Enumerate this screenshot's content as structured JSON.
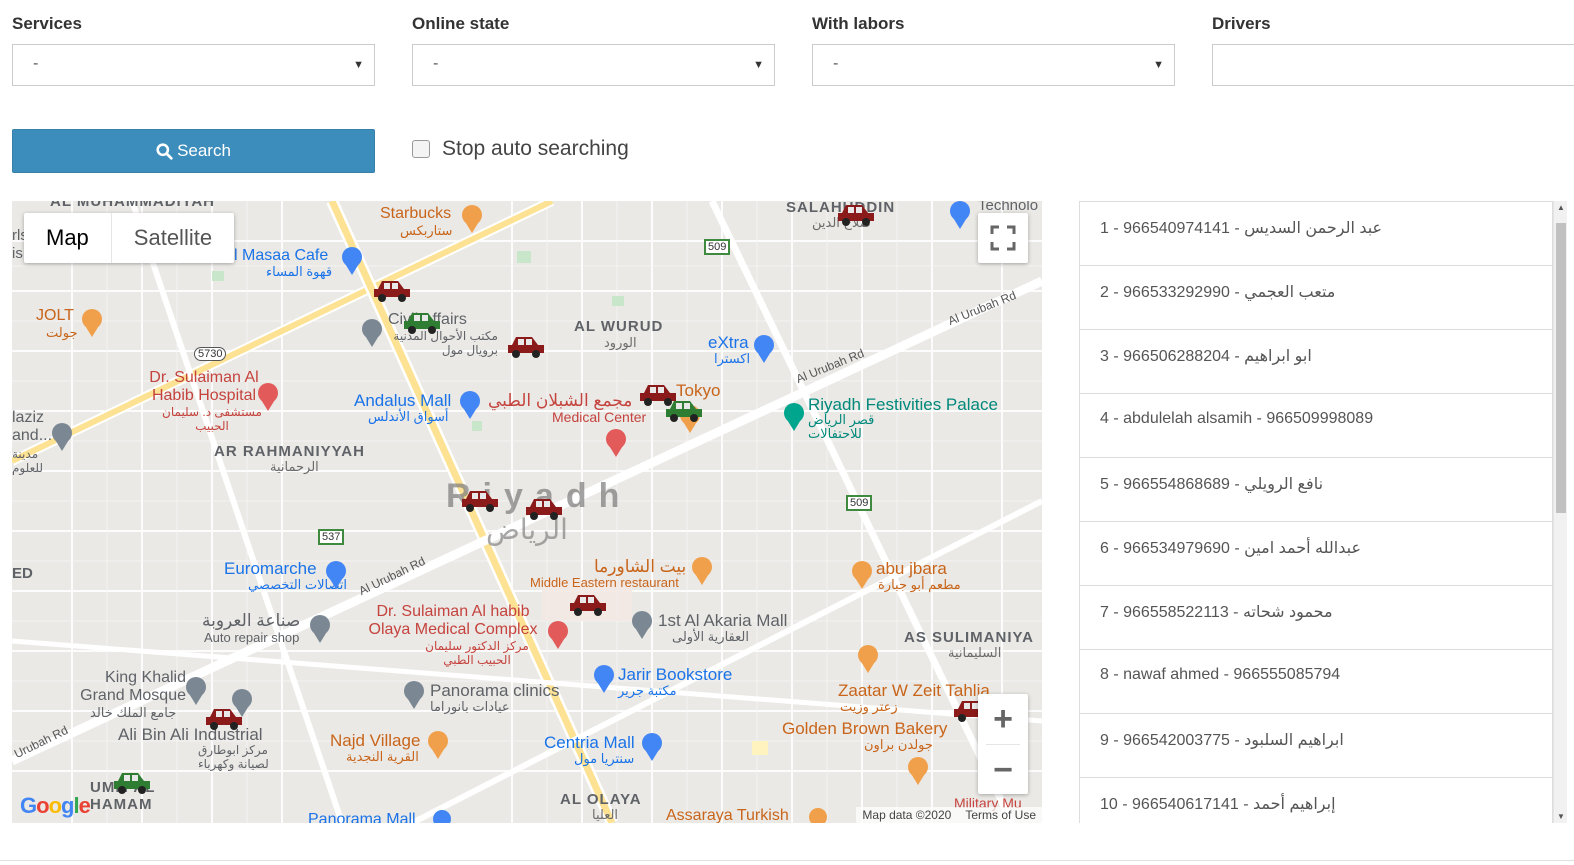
{
  "filters": {
    "services": {
      "label": "Services",
      "value": "-"
    },
    "online_state": {
      "label": "Online state",
      "value": "-"
    },
    "with_labors": {
      "label": "With labors",
      "value": "-"
    },
    "drivers": {
      "label": "Drivers",
      "value": ""
    }
  },
  "search_button": {
    "label": "Search",
    "icon": "search-icon"
  },
  "stop_auto": {
    "label": "Stop auto searching",
    "checked": false
  },
  "map": {
    "type_controls": {
      "map": "Map",
      "satellite": "Satellite",
      "selected": "Map"
    },
    "attribution": {
      "data": "Map data ©2020",
      "terms": "Terms of Use"
    },
    "logo": "Google",
    "city": {
      "name_en": "Riyadh",
      "name_ar": "الرياض"
    },
    "labels": {
      "salahuddin": "SALAHUDDIN",
      "salahuddin_ar": "صلاح الدين",
      "al_wurud": "AL WURUD",
      "al_wurud_ar": "الورود",
      "ar_rahmaniyyah": "AR RAHMANIYYAH",
      "ar_rahmaniyyah_ar": "الرحمانية",
      "as_sulimaniya": "AS SULIMANIYA",
      "as_sulimaniya_ar": "السليمانية",
      "al_olaya": "AL OLAYA",
      "al_olaya_ar": "العليا",
      "umm_al_hamam": "UMM AL HAMAM",
      "al_muhammadiyah": "AL MUHAMMADIYAH",
      "starbucks": "Starbucks",
      "starbucks_ar": "ستاربكس",
      "masaa_cafe": "l Masaa Cafe",
      "masaa_cafe_ar": "قهوة المساء",
      "jolt": "JOLT",
      "jolt_ar": "جولت",
      "civil_affairs": "Civil Affairs",
      "civil_affairs_ar": "مكتب الأحوال المدنية برويال مول",
      "extra": "eXtra",
      "extra_ar": "اكسترا",
      "dr_sulaiman_habib": "Dr. Sulaiman Al Habib Hospital",
      "dr_sulaiman_habib_ar": "مستشفى د. سليمان الحبيب",
      "andalus_mall": "Andalus Mall",
      "andalus_mall_ar": "أسواق الأندلس",
      "shblan_medical": "مجمع الشبلان الطبي",
      "medical_center": "Medical Center",
      "tokyo": "Tokyo",
      "festivities_palace": "Riyadh Festivities Palace",
      "festivities_palace_ar": "قصر الرياض للاحتفالات",
      "euromarche": "Euromarche",
      "euromarche_ar": "اتصالات التخصصي",
      "shawarma_house": "بيت الشاورما",
      "middle_eastern": "Middle Eastern restaurant",
      "abu_jbara": "abu jbara",
      "abu_jbara_ar": "مطعم أبو جبارة",
      "auto_repair": "صناعة العروبة",
      "auto_repair_en": "Auto repair shop",
      "olaya_medical": "Dr. Sulaiman Al habib Olaya Medical Complex",
      "olaya_medical_ar": "مركز الدكتور سليمان الحبيب الطبي",
      "akaria_mall": "1st Al Akaria Mall",
      "akaria_mall_ar": "العقارية الأولى",
      "jarir": "Jarir Bookstore",
      "jarir_ar": "مكتبة جرير",
      "king_khalid": "King Khalid Grand Mosque",
      "king_khalid_ar": "جامع الملك خالد",
      "panorama_clinics": "Panorama clinics",
      "panorama_clinics_ar": "عيادات بانوراما",
      "zaatar": "Zaatar W Zeit Tahlia",
      "zaatar_ar": "زعتر وزيت",
      "ali_bin_ali": "Ali Bin Ali Industrial",
      "ali_bin_ali_ar": "مركز ابوطارق لصيانة وكهرباء",
      "najd_village": "Najd Village",
      "najd_village_ar": "القرية النجدية",
      "centria_mall": "Centria Mall",
      "centria_mall_ar": "سنتريا مول",
      "golden_brown": "Golden Brown Bakery",
      "golden_brown_ar": "جولدن براون",
      "panorama_mall": "Panorama Mall",
      "assaraya": "Assaraya Turkish",
      "military": "Military Mu",
      "road_urubah_1": "Al Urubah Rd",
      "road_urubah_2": "Al Urubah Rd",
      "road_urubah_3": "Al Urubah Rd",
      "road_urubah_4": "Urubah Rd",
      "shield_509a": "509",
      "shield_509b": "509",
      "shield_537": "537",
      "shield_5730": "5730",
      "aziz": "laziz",
      "and": "and...",
      "aziz_ar": "مدينة للعلوم",
      "rls": "rls",
      "is": "is",
      "ed": "ED",
      "technolo": "Technolo"
    },
    "cars": [
      {
        "color": "#8b1a1a",
        "status": "red"
      },
      {
        "color": "#2e7d32",
        "status": "green"
      },
      {
        "color": "#8b1a1a",
        "status": "red"
      },
      {
        "color": "#8b1a1a",
        "status": "red"
      },
      {
        "color": "#2e7d32",
        "status": "green"
      },
      {
        "color": "#8b1a1a",
        "status": "red"
      },
      {
        "color": "#8b1a1a",
        "status": "red"
      },
      {
        "color": "#8b1a1a",
        "status": "red"
      },
      {
        "color": "#8b1a1a",
        "status": "red"
      },
      {
        "color": "#2e7d32",
        "status": "green"
      },
      {
        "color": "#8b1a1a",
        "status": "red"
      },
      {
        "color": "#8b1a1a",
        "status": "red"
      }
    ]
  },
  "drivers_list": [
    "1 - 966540974141 - عبد الرحمن السديس",
    "2 - 966533292990 - متعب العجمي",
    "3 - 966506288204 - ابو ابراهيم",
    "4 - abdulelah alsamih - 966509998089",
    "5 - 966554868689 - نافع الرويلي",
    "6 - 966534979690 - عبدالله أحمد امين",
    "7 - 966558522113 - محمود شحاته",
    "8 - nawaf ahmed - 966555085794",
    "9 - 966542003775 - ابراهيم السلبود",
    "10 - 966540617141 - إبراهيم أحمد"
  ],
  "colors": {
    "accent": "#3c8dbc",
    "car_busy": "#8b1a1a",
    "car_free": "#2e7d32",
    "poi_orange": "#f0a04b",
    "poi_blue": "#4285f4",
    "poi_red": "#e25a5a"
  }
}
